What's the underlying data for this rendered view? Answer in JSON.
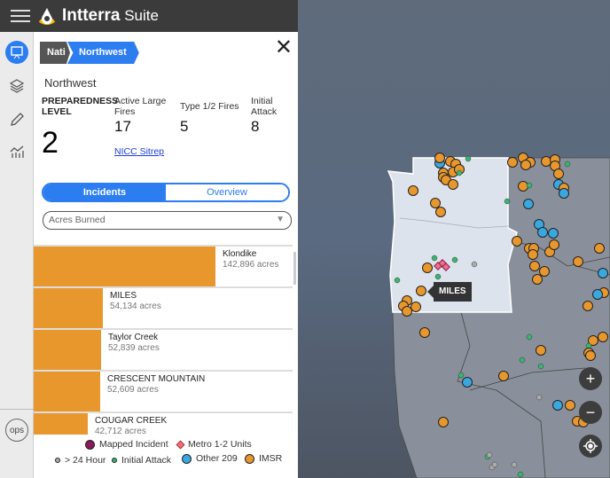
{
  "app": {
    "title_bold": "Intterra",
    "title_rest": " Suite"
  },
  "breadcrumb": [
    "Nati",
    "Northwest"
  ],
  "region": "Northwest",
  "stats": {
    "preparedness_label": "PREPAREDNESS LEVEL",
    "preparedness": "2",
    "active_label": "Active Large Fires",
    "active": "17",
    "type12_label": "Type 1/2 Fires",
    "type12": "5",
    "ia_label": "Initial Attack",
    "ia": "8",
    "sitrep": "NICC Sitrep"
  },
  "tabs": {
    "incidents": "Incidents",
    "overview": "Overview",
    "active": "Incidents"
  },
  "dropdown": {
    "value": "Acres Burned"
  },
  "incidents": [
    {
      "name": "Klondike",
      "acres": "142,896 acres",
      "value": 142896
    },
    {
      "name": "MILES",
      "acres": "54,134 acres",
      "value": 54134
    },
    {
      "name": "Taylor Creek",
      "acres": "52,839 acres",
      "value": 52839
    },
    {
      "name": "CRESCENT MOUNTAIN",
      "acres": "52,609 acres",
      "value": 52609
    },
    {
      "name": "COUGAR CREEK",
      "acres": "42,712 acres",
      "value": 42712
    }
  ],
  "legend": {
    "mapped": "Mapped Incident",
    "metro": "Metro 1-2 Units",
    "hour24": "> 24 Hour",
    "ia": "Initial Attack",
    "other": "Other 209",
    "imsr": "IMSR"
  },
  "colors": {
    "accent": "#2b7df0",
    "imsr": "#e8972d",
    "other209": "#3aa8e0",
    "initial_attack": "#3cb371",
    "hour24": "#aaaaaa",
    "mapped": "#8b1a5a",
    "metro": "#f07080"
  },
  "map": {
    "tooltip": "MILES",
    "zoom_in": "+",
    "zoom_out": "−"
  },
  "rail": {
    "ops": "ops"
  }
}
